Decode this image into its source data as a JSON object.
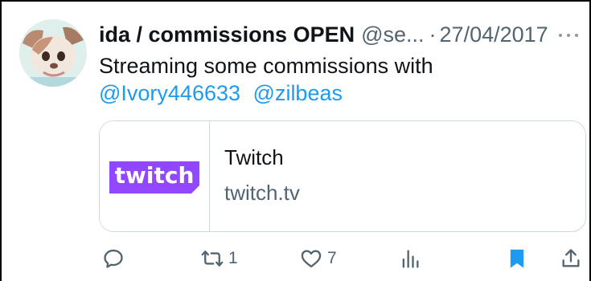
{
  "tweet": {
    "author_name": "ida / commissions OPEN",
    "handle": "@se...",
    "separator": "·",
    "date": "27/04/2017",
    "text_line": "Streaming some commissions with",
    "mentions": [
      "@Ivory446633",
      "@zilbeas"
    ]
  },
  "card": {
    "logo_text": "twitch",
    "title": "Twitch",
    "domain": "twitch.tv"
  },
  "actions": {
    "retweets": "1",
    "likes": "7"
  },
  "colors": {
    "link": "#1d9bf0",
    "muted": "#536471",
    "twitch_purple": "#9146ff",
    "bookmark": "#1d9bf0"
  },
  "icons": [
    "reply-icon",
    "retweet-icon",
    "like-icon",
    "views-icon",
    "bookmark-icon",
    "share-icon",
    "more-icon"
  ]
}
